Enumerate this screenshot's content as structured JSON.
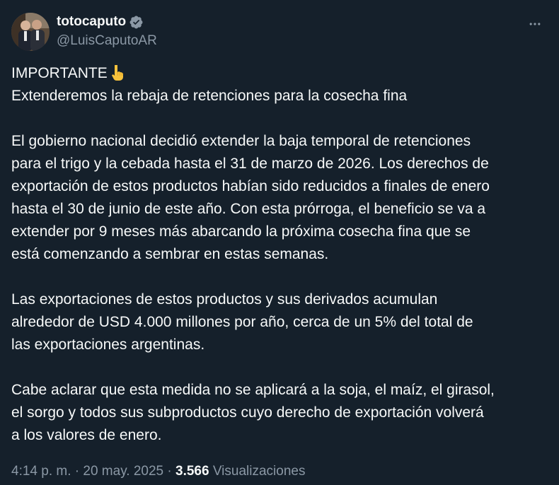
{
  "author": {
    "display_name": "totocaputo",
    "handle": "@LuisCaputoAR",
    "verified": true,
    "avatar_icon": "avatar-photo"
  },
  "actions": {
    "more_icon": "more-dots-icon"
  },
  "tweet": {
    "heading": "IMPORTANTE",
    "heading_emoji": "pointing-down-emoji",
    "subheading": "Extenderemos la rebaja de retenciones para la cosecha fina",
    "paragraph_1_lines": [
      "El gobierno nacional decidió extender la baja temporal de retenciones",
      "para el trigo y la cebada hasta el 31 de marzo de 2026. Los derechos de",
      "exportación de estos productos habían sido reducidos a finales de enero",
      "hasta el 30 de junio de este año. Con esta prórroga, el beneficio se va a",
      "extender por 9 meses más abarcando la próxima cosecha fina que se",
      "está comenzando a sembrar en estas semanas."
    ],
    "paragraph_2_lines": [
      "Las exportaciones de estos productos y sus derivados acumulan",
      "alrededor de USD 4.000 millones por año, cerca de un 5% del total de",
      "las exportaciones argentinas."
    ],
    "paragraph_3_lines": [
      "Cabe aclarar que esta medida no se aplicará a la soja, el maíz, el girasol,",
      "el sorgo y todos sus subproductos cuyo derecho de exportación volverá",
      "a los valores de enero."
    ]
  },
  "meta": {
    "time": "4:14 p. m.",
    "separator": " · ",
    "date": "20 may. 2025",
    "views_count": "3.566",
    "views_label": "Visualizaciones"
  },
  "colors": {
    "background": "#15202b",
    "text_primary": "#f7f9f9",
    "text_secondary": "#8b98a5",
    "verified": "#1d9bf0"
  }
}
